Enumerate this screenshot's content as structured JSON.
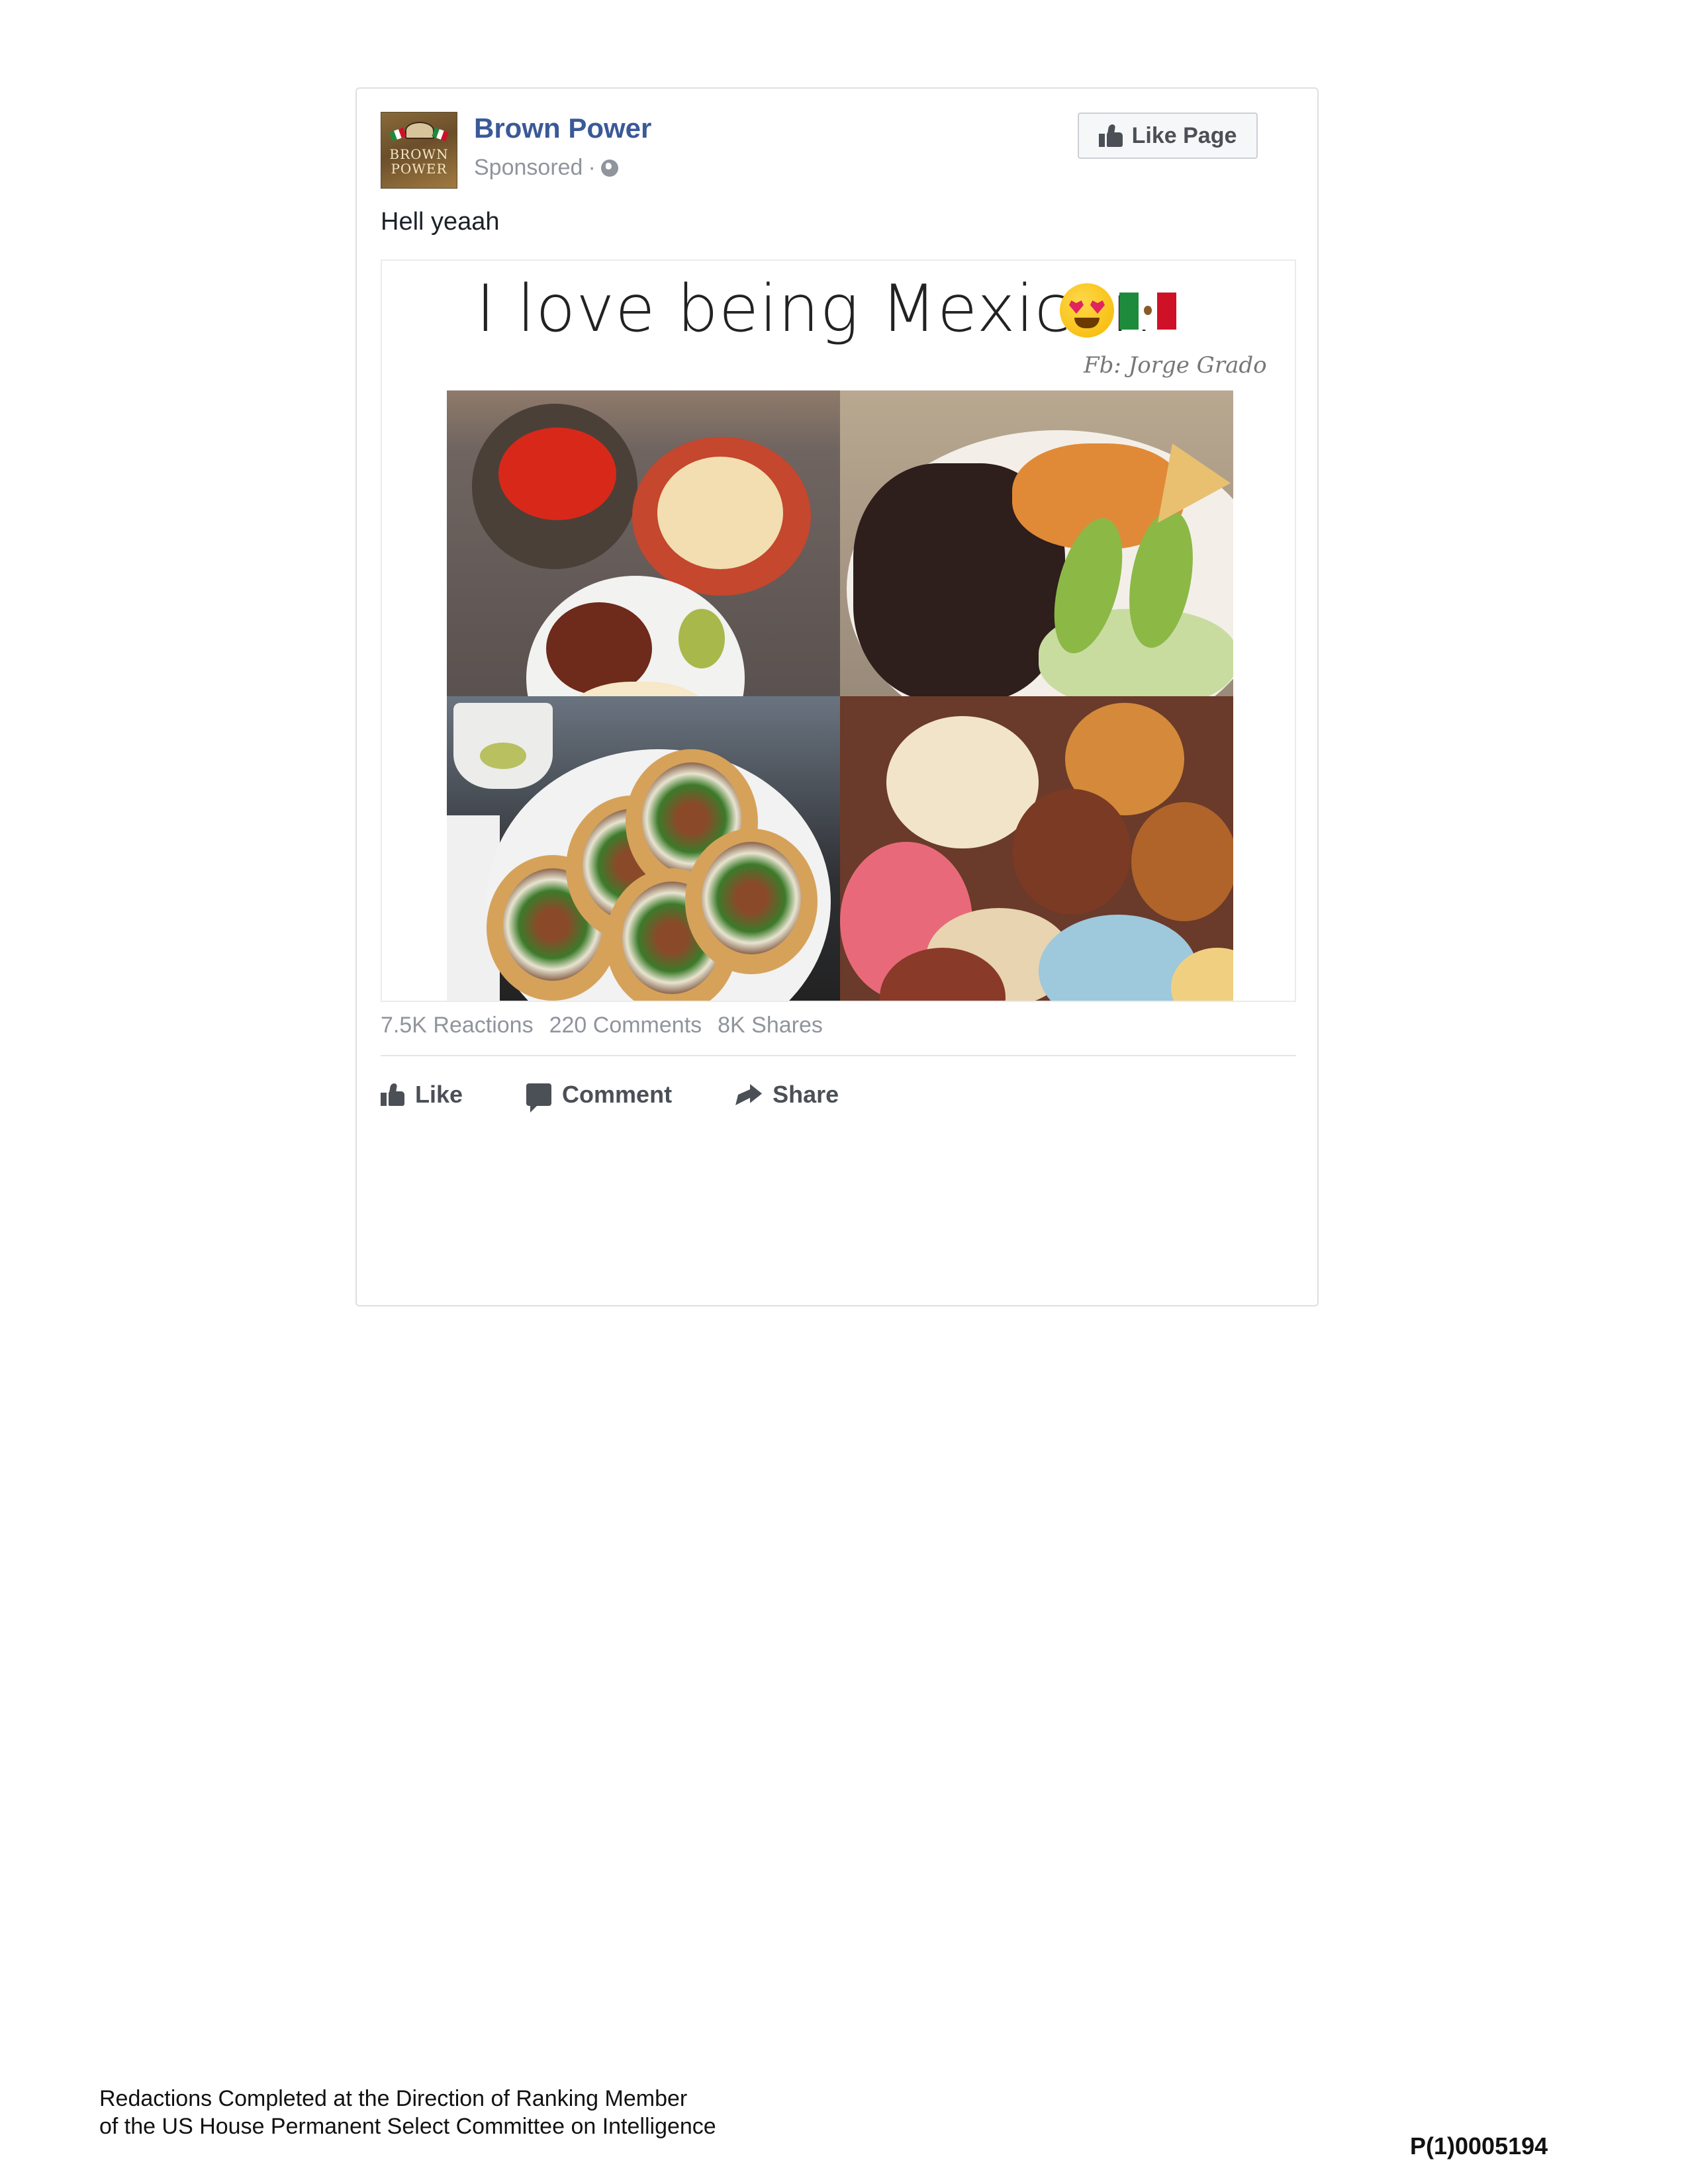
{
  "post": {
    "page_name": "Brown Power",
    "sponsored_label": "Sponsored",
    "separator": "·",
    "like_page_label": "Like Page",
    "message": "Hell yeaah",
    "avatar_text": [
      "BROWN",
      "POWER"
    ],
    "media": {
      "headline": "I love being Mexican",
      "credit": "Fb: Jorge Grado"
    },
    "stats": {
      "reactions": "7.5K Reactions",
      "comments": "220 Comments",
      "shares": "8K Shares"
    },
    "actions": {
      "like": "Like",
      "comment": "Comment",
      "share": "Share"
    }
  },
  "footer": {
    "note_line1": "Redactions Completed at the Direction of Ranking Member",
    "note_line2": "of the US House Permanent Select Committee on Intelligence",
    "doc_id": "P(1)0005194"
  },
  "colors": {
    "brand_blue": "#3b5998",
    "muted_text": "#90949c",
    "action_text": "#4b4f56",
    "flag_green": "#1e8a3c",
    "flag_red": "#ce1126"
  },
  "icons": [
    "thumbs-up-icon",
    "globe-icon",
    "comment-icon",
    "share-icon",
    "heart-eyes-emoji-icon",
    "mexico-flag-icon"
  ]
}
